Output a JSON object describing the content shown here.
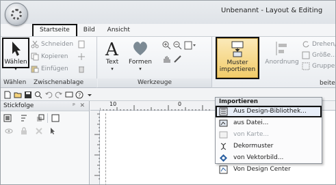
{
  "window": {
    "title": "Unbenannt - Layout & Editing"
  },
  "tabs": [
    {
      "label": "Startseite",
      "active": true
    },
    {
      "label": "Bild",
      "active": false
    },
    {
      "label": "Ansicht",
      "active": false
    }
  ],
  "ribbon": {
    "clipboard": {
      "label": "Zwischenablage",
      "waehlen": "Wählen",
      "ausschneiden": "Schneiden",
      "kopieren": "Kopieren",
      "einfuegen": "Einfügen"
    },
    "left_group_label": "Wählen",
    "tools": {
      "label": "Werkzeuge",
      "text": "Text",
      "formen": "Formen"
    },
    "muster": {
      "line1": "Muster",
      "line2": "importieren"
    },
    "anordnung": "Anordnung",
    "edit": {
      "drehen": "Drehen/",
      "groesse": "Größe...",
      "gruppe": "Gruppe",
      "bearbeiten": "beiten"
    }
  },
  "panel": {
    "title": "Stickfolge",
    "pin": "ᵖ",
    "close": "✕"
  },
  "ruler": {
    "marks": [
      "10",
      "0"
    ]
  },
  "menu": {
    "header": "Importieren",
    "items": [
      {
        "label": "Aus Design-Bibliothek...",
        "highlighted": true,
        "disabled": false,
        "icon": "library-icon"
      },
      {
        "label": "aus Datei...",
        "highlighted": false,
        "disabled": false,
        "icon": "file-icon"
      },
      {
        "label": "von Karte...",
        "highlighted": false,
        "disabled": true,
        "icon": "card-icon"
      },
      {
        "label": "Dekormuster",
        "highlighted": false,
        "disabled": false,
        "icon": "decor-icon"
      },
      {
        "label": "von Vektorbild...",
        "highlighted": false,
        "disabled": false,
        "icon": "vector-icon"
      },
      {
        "label": "Von Design Center",
        "highlighted": false,
        "disabled": false,
        "icon": "design-center-icon"
      }
    ]
  }
}
